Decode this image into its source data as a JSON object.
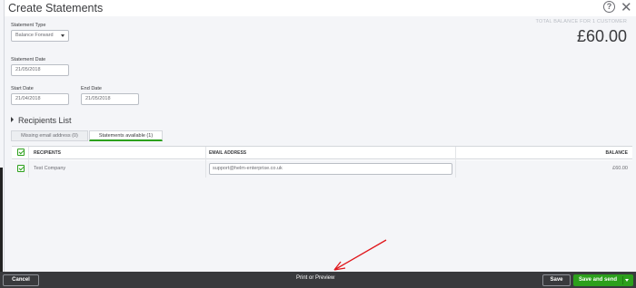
{
  "dialog": {
    "title": "Create Statements"
  },
  "form": {
    "statement_type": {
      "label": "Statement Type",
      "value": "Balance Forward"
    },
    "statement_date": {
      "label": "Statement Date",
      "value": "21/05/2018"
    },
    "start_date": {
      "label": "Start Date",
      "value": "21/04/2018"
    },
    "end_date": {
      "label": "End Date",
      "value": "21/05/2018"
    }
  },
  "total": {
    "label": "TOTAL BALANCE FOR 1 CUSTOMER",
    "value": "£60.00"
  },
  "recipients": {
    "heading": "Recipients List",
    "tabs": [
      {
        "label": "Missing email address (0)",
        "active": false
      },
      {
        "label": "Statements available (1)",
        "active": true
      }
    ],
    "columns": {
      "recipients": "RECIPIENTS",
      "email": "EMAIL ADDRESS",
      "balance": "BALANCE"
    },
    "rows": [
      {
        "name": "Test Company",
        "email": "support@helm-enterprise.co.uk",
        "balance": "£60.00",
        "checked": true
      }
    ]
  },
  "footer": {
    "cancel": "Cancel",
    "print": "Print or Preview",
    "save": "Save",
    "save_and_send": "Save and send"
  },
  "colors": {
    "accent": "#2ca01c",
    "footer_bg": "#393a3d",
    "annotation": "#e0161b"
  },
  "icons": [
    "help-icon",
    "close-icon",
    "chevron-down-icon",
    "checkbox-icon"
  ]
}
